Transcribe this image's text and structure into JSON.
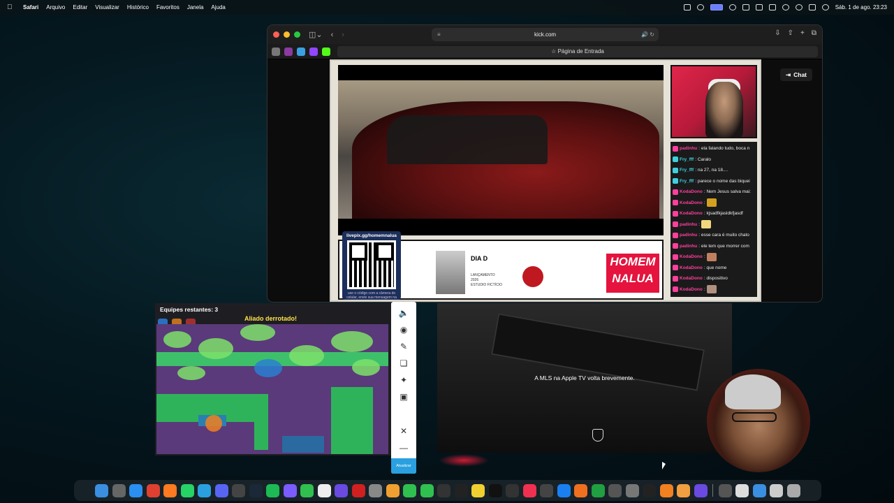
{
  "menubar": {
    "app": "Safari",
    "items": [
      "Arquivo",
      "Editar",
      "Visualizar",
      "Histórico",
      "Favoritos",
      "Janela",
      "Ajuda"
    ],
    "clock": "Sáb. 1 de ago.  23:23"
  },
  "safari": {
    "url": "kick.com",
    "tab": "Página de Entrada",
    "chat_button": "Chat"
  },
  "stream": {
    "qr_title": "livepix.gg/homemnalua",
    "qr_sub": "use o código com a câmera do celular, envie sua mensagem na",
    "poster_title": "DIA D",
    "poster_launch": "LANÇAMENTO",
    "poster_year": "2026",
    "poster_sub": "ESTUDIO FICTÍCIO",
    "logo": "HOMEM NALUA",
    "chat": [
      {
        "user": "padinhu",
        "text": ": ela falando tudo, boca n",
        "color": "#ff3f9c",
        "badge": "#ff3f9c"
      },
      {
        "user": "Fry_fff",
        "text": ": Caralo",
        "color": "#3fd0e0",
        "badge": "#3fd0e0"
      },
      {
        "user": "Fry_fff",
        "text": ": na 27, na 18....",
        "color": "#3fd0e0",
        "badge": "#3fd0e0"
      },
      {
        "user": "Fry_fff",
        "text": ": parece o nome das biquei",
        "color": "#3fd0e0",
        "badge": "#3fd0e0"
      },
      {
        "user": "KodaDono",
        "text": ": Nem Jesus salva mai:",
        "color": "#ff3f9c",
        "badge": "#ff3f9c"
      },
      {
        "user": "KodaDono",
        "text": ":",
        "color": "#ff3f9c",
        "badge": "#ff3f9c",
        "emote": "#d4a020"
      },
      {
        "user": "KodaDono",
        "text": ": kjsadfkjasldkfjasdf",
        "color": "#ff3f9c",
        "badge": "#ff3f9c"
      },
      {
        "user": "padinhu",
        "text": ":",
        "color": "#ff3f9c",
        "badge": "#ff3f9c",
        "emote": "#f0d880"
      },
      {
        "user": "padinhu",
        "text": ": esse cara é muito chato",
        "color": "#ff3f9c",
        "badge": "#ff3f9c"
      },
      {
        "user": "padinhu",
        "text": ": ele tem que morrer com",
        "color": "#ff3f9c",
        "badge": "#ff3f9c"
      },
      {
        "user": "KodaDono",
        "text": ":",
        "color": "#ff3f9c",
        "badge": "#ff3f9c",
        "emote": "#c08060"
      },
      {
        "user": "KodaDono",
        "text": ": que nome",
        "color": "#ff3f9c",
        "badge": "#ff3f9c"
      },
      {
        "user": "KodaDono",
        "text": ": dispositivo",
        "color": "#ff3f9c",
        "badge": "#ff3f9c"
      },
      {
        "user": "KodaDono",
        "text": ":",
        "color": "#ff3f9c",
        "badge": "#ff3f9c",
        "emote": "#b09080"
      }
    ]
  },
  "game": {
    "teams_left": "Equipes restantes: 3",
    "status": "Aliado derrotado!"
  },
  "tools": {
    "update_label": "Atualizar"
  },
  "tv": {
    "message": "A MLS na Apple TV volta brevemente."
  },
  "dock_icons": [
    {
      "name": "finder-icon",
      "color": "#3a8fe0"
    },
    {
      "name": "launchpad-icon",
      "color": "#666"
    },
    {
      "name": "safari-icon",
      "color": "#2a8ff0"
    },
    {
      "name": "chrome-icon",
      "color": "#e04030"
    },
    {
      "name": "firefox-icon",
      "color": "#ff7a20"
    },
    {
      "name": "whatsapp-icon",
      "color": "#25d366"
    },
    {
      "name": "telegram-icon",
      "color": "#2aa0e0"
    },
    {
      "name": "discord-icon",
      "color": "#5865f2"
    },
    {
      "name": "scrivener-icon",
      "color": "#444"
    },
    {
      "name": "steam-icon",
      "color": "#1b2838"
    },
    {
      "name": "spotify-icon",
      "color": "#1db954"
    },
    {
      "name": "tana-icon",
      "color": "#7a5cff"
    },
    {
      "name": "messages-icon",
      "color": "#30c050"
    },
    {
      "name": "chatgpt-icon",
      "color": "#eee"
    },
    {
      "name": "perplexity-icon",
      "color": "#6a4ae0"
    },
    {
      "name": "nuts-icon",
      "color": "#d02020"
    },
    {
      "name": "screenshot-icon",
      "color": "#888"
    },
    {
      "name": "photos-icon",
      "color": "#f0a030"
    },
    {
      "name": "facetime-icon",
      "color": "#30c050"
    },
    {
      "name": "phone-icon",
      "color": "#30c050"
    },
    {
      "name": "obs-icon",
      "color": "#333"
    },
    {
      "name": "clock-icon",
      "color": "#222"
    },
    {
      "name": "notes-icon",
      "color": "#f0d030"
    },
    {
      "name": "appletv-icon",
      "color": "#111"
    },
    {
      "name": "shortcuts-icon",
      "color": "#333"
    },
    {
      "name": "music-icon",
      "color": "#f03050"
    },
    {
      "name": "claquete-icon",
      "color": "#444"
    },
    {
      "name": "appstore-icon",
      "color": "#1a80f0"
    },
    {
      "name": "pencil-icon",
      "color": "#f07020"
    },
    {
      "name": "numbers-icon",
      "color": "#20a040"
    },
    {
      "name": "calculator-icon",
      "color": "#555"
    },
    {
      "name": "settings-icon",
      "color": "#777"
    },
    {
      "name": "terminal-icon",
      "color": "#222"
    },
    {
      "name": "vlc-icon",
      "color": "#f08020"
    },
    {
      "name": "browser-icon",
      "color": "#f0a040"
    },
    {
      "name": "gpt-icon",
      "color": "#6a4ae0"
    },
    {
      "name": "folder-icon",
      "color": "#555"
    },
    {
      "name": "document-icon",
      "color": "#ddd"
    },
    {
      "name": "kick-icon",
      "color": "#3a8fe0"
    },
    {
      "name": "downloads-icon",
      "color": "#ccc"
    },
    {
      "name": "trash-icon",
      "color": "#aaa"
    }
  ]
}
